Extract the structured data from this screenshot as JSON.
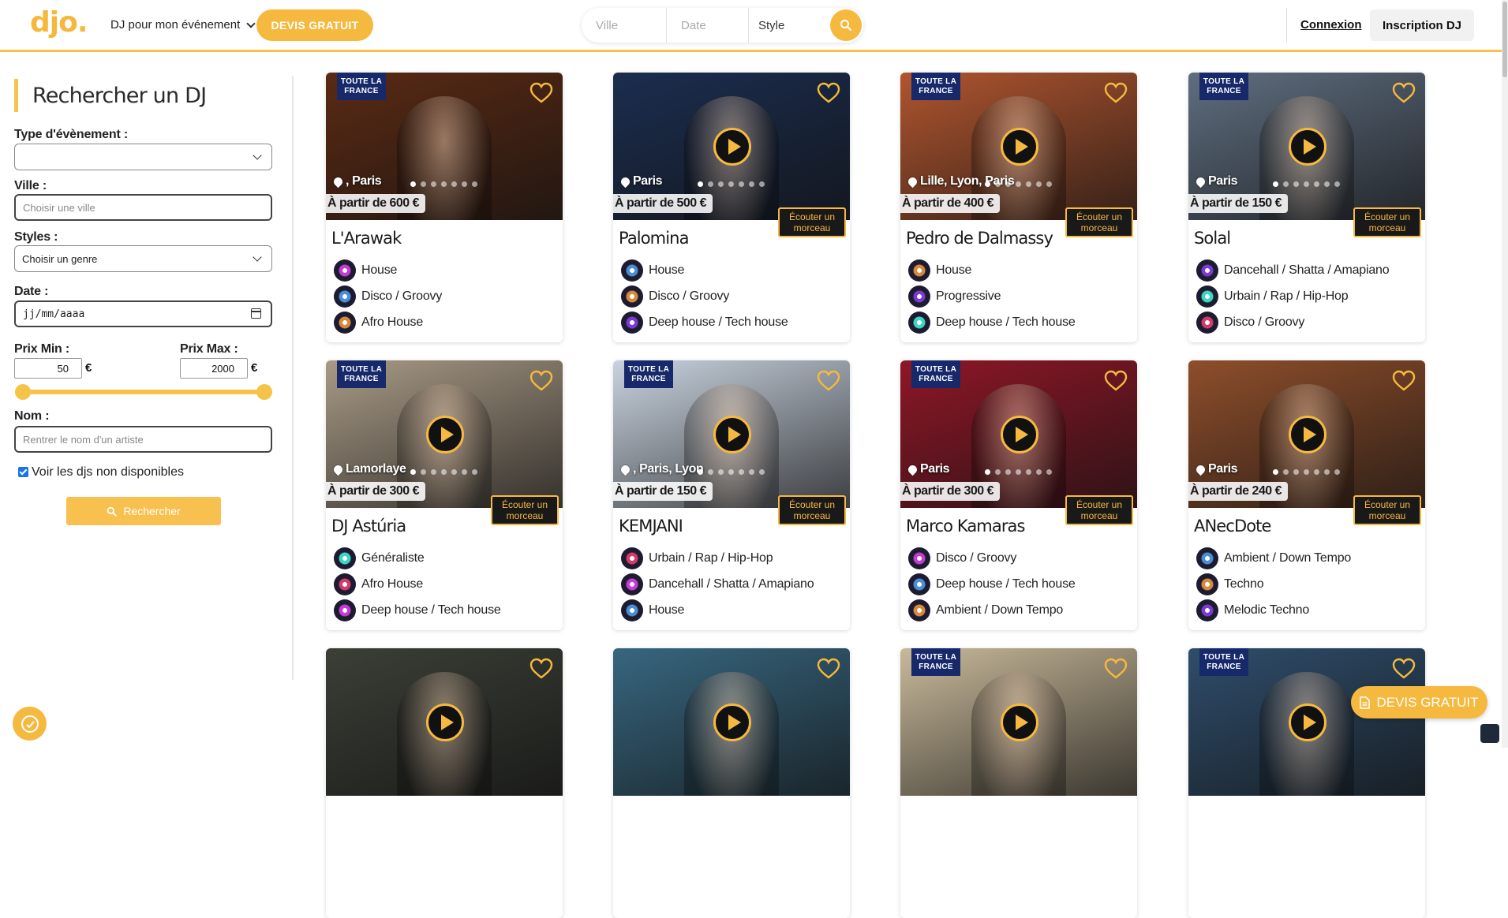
{
  "header": {
    "logo": "djo.",
    "nav_dropdown": "DJ pour mon événement",
    "devis_button": "DEVIS GRATUIT",
    "search": {
      "ville_placeholder": "Ville",
      "date_placeholder": "Date",
      "style_placeholder": "Style"
    },
    "connexion": "Connexion",
    "inscription": "Inscription DJ"
  },
  "sidebar": {
    "title": "Rechercher un DJ",
    "event_type_label": "Type d'évènement :",
    "event_type_value": "",
    "ville_label": "Ville :",
    "ville_placeholder": "Choisir une ville",
    "styles_label": "Styles :",
    "styles_value": "Choisir un genre",
    "date_label": "Date :",
    "date_value": "jj/mm/aaaa",
    "prix_min_label": "Prix Min :",
    "prix_max_label": "Prix Max :",
    "prix_min": "50",
    "prix_max": "2000",
    "euro": "€",
    "nom_label": "Nom :",
    "nom_placeholder": "Rentrer le nom d'un artiste",
    "checkbox_label": "Voir les djs non disponibles",
    "checkbox_checked": true,
    "search_button": "Rechercher"
  },
  "card_labels": {
    "ribbon_line1": "TOUTE LA",
    "ribbon_line2": "FRANCE",
    "ecouter": "Écouter un morceau"
  },
  "cards": [
    {
      "name": "L'Arawak",
      "location": ", Paris",
      "price": "À partir de 600 €",
      "ribbon": true,
      "ecouter": false,
      "play": false,
      "photo": "#5a2a14",
      "genres": [
        "House",
        "Disco / Groovy",
        "Afro House"
      ]
    },
    {
      "name": "Palomina",
      "location": "Paris",
      "price": "À partir de 500 €",
      "ribbon": false,
      "ecouter": true,
      "play": true,
      "photo": "#1b2d4f",
      "genres": [
        "House",
        "Disco / Groovy",
        "Deep house / Tech house"
      ]
    },
    {
      "name": "Pedro de Dalmassy",
      "location": "Lille, Lyon, Paris",
      "price": "À partir de 400 €",
      "ribbon": true,
      "ecouter": true,
      "play": true,
      "photo": "#b0552f",
      "genres": [
        "House",
        "Progressive",
        "Deep house / Tech house"
      ]
    },
    {
      "name": "Solal",
      "location": "Paris",
      "price": "À partir de 150 €",
      "ribbon": true,
      "ecouter": true,
      "play": true,
      "photo": "#5f6e80",
      "genres": [
        "Dancehall / Shatta / Amapiano",
        "Urbain / Rap / Hip-Hop",
        "Disco / Groovy"
      ]
    },
    {
      "name": "DJ Astúria",
      "location": "Lamorlaye",
      "price": "À partir de 300 €",
      "ribbon": true,
      "ecouter": true,
      "play": true,
      "photo": "#a89a86",
      "genres": [
        "Généraliste",
        "Afro House",
        "Deep house / Tech house"
      ]
    },
    {
      "name": "KEMJANI",
      "location": ", Paris, Lyon",
      "price": "À partir de 150 €",
      "ribbon": true,
      "ecouter": true,
      "play": true,
      "photo": "#c9d3df",
      "genres": [
        "Urbain / Rap / Hip-Hop",
        "Dancehall / Shatta / Amapiano",
        "House"
      ]
    },
    {
      "name": "Marco Kamaras",
      "location": "Paris",
      "price": "À partir de 300 €",
      "ribbon": true,
      "ecouter": true,
      "play": true,
      "photo": "#8e1727",
      "genres": [
        "Disco / Groovy",
        "Deep house / Tech house",
        "Ambient / Down Tempo"
      ]
    },
    {
      "name": "ANecDote",
      "location": "Paris",
      "price": "À partir de 240 €",
      "ribbon": false,
      "ecouter": true,
      "play": true,
      "photo": "#8e4e2b",
      "genres": [
        "Ambient / Down Tempo",
        "Techno",
        "Melodic Techno"
      ]
    },
    {
      "name": "",
      "location": "",
      "price": "",
      "ribbon": false,
      "ecouter": false,
      "play": true,
      "photo": "#3b3f36",
      "genres": []
    },
    {
      "name": "",
      "location": "",
      "price": "",
      "ribbon": false,
      "ecouter": false,
      "play": true,
      "photo": "#37667f",
      "genres": []
    },
    {
      "name": "",
      "location": "",
      "price": "",
      "ribbon": true,
      "ecouter": false,
      "play": true,
      "photo": "#c8b99a",
      "genres": []
    },
    {
      "name": "",
      "location": "",
      "price": "",
      "ribbon": true,
      "ecouter": false,
      "play": true,
      "photo": "#2f4d6b",
      "genres": []
    }
  ],
  "float_devis": "DEVIS GRATUIT",
  "colors": {
    "accent": "#f6b93f",
    "ribbon": "#17296b"
  }
}
